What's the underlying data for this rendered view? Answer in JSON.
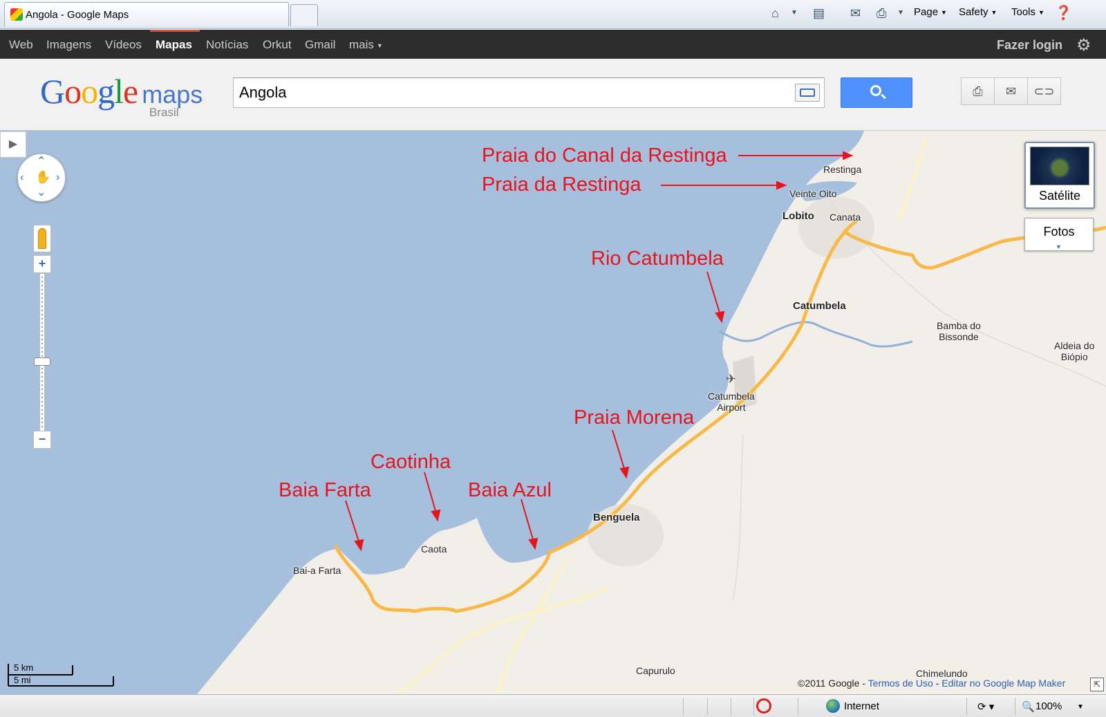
{
  "browser": {
    "tab_title": "Angola - Google Maps",
    "menus": [
      {
        "label": "Page"
      },
      {
        "label": "Safety"
      },
      {
        "label": "Tools"
      }
    ]
  },
  "gnav": {
    "items": [
      {
        "label": "Web"
      },
      {
        "label": "Imagens"
      },
      {
        "label": "Vídeos"
      },
      {
        "label": "Mapas",
        "active": true
      },
      {
        "label": "Notícias"
      },
      {
        "label": "Orkut"
      },
      {
        "label": "Gmail"
      },
      {
        "label": "mais"
      }
    ],
    "login": "Fazer login"
  },
  "header": {
    "logo_google": "Google",
    "logo_maps": "maps",
    "logo_region": "Brasil",
    "search_value": "Angola"
  },
  "map": {
    "zoom_level_fraction": 0.55,
    "layer_buttons": {
      "satellite": "Satélite",
      "photos": "Fotos"
    },
    "places": [
      {
        "name": "Restinga",
        "bold": false
      },
      {
        "name": "Veinte Oito",
        "bold": false
      },
      {
        "name": "Lobito",
        "bold": true
      },
      {
        "name": "Canata",
        "bold": false
      },
      {
        "name": "Catumbela",
        "bold": true
      },
      {
        "name": "Bamba do\nBissonde",
        "bold": false
      },
      {
        "name": "Aldeia do\nBiópio",
        "bold": false
      },
      {
        "name": "Catumbela\nAirport",
        "bold": false
      },
      {
        "name": "Benguela",
        "bold": true
      },
      {
        "name": "Caota",
        "bold": false
      },
      {
        "name": "Bai-a Farta",
        "bold": false
      },
      {
        "name": "Capurulo",
        "bold": false
      },
      {
        "name": "Chimelundo",
        "bold": false
      }
    ],
    "annotations": [
      {
        "text": "Praia do Canal da Restinga"
      },
      {
        "text": "Praia da Restinga"
      },
      {
        "text": "Rio Catumbela"
      },
      {
        "text": "Praia Morena"
      },
      {
        "text": "Caotinha"
      },
      {
        "text": "Baia Farta"
      },
      {
        "text": "Baia Azul"
      }
    ],
    "scale": {
      "km": "5 km",
      "mi": "5 mi"
    },
    "copyright": {
      "text": "©2011 Google - ",
      "terms": "Termos de Uso",
      "sep": " - ",
      "edit": "Editar no Google Map Maker"
    },
    "colors": {
      "water": "#a5bfdd",
      "land": "#f2efe9",
      "highway": "#f9b94a",
      "annotation": "#e8141c"
    }
  },
  "status": {
    "zone": "Internet",
    "zoom": "100%"
  }
}
